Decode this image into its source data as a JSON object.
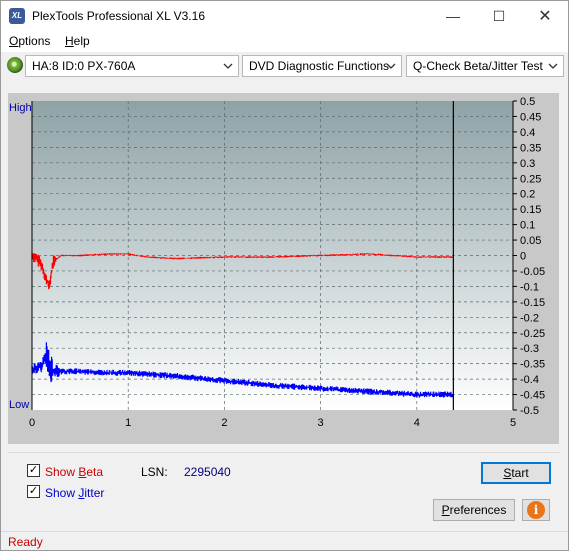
{
  "window": {
    "title": "PlexTools Professional XL V3.16"
  },
  "menu": {
    "options": "ptions",
    "options_key": "O",
    "help": "elp",
    "help_key": "H"
  },
  "toolbar": {
    "drive": "HA:8 ID:0  PX-760A",
    "function": "DVD Diagnostic Functions",
    "test": "Q-Check Beta/Jitter Test"
  },
  "chart_data": {
    "type": "line",
    "left_axis_labels": {
      "high": "High",
      "low": "Low"
    },
    "x_ticks": [
      "0",
      "1",
      "2",
      "3",
      "4",
      "5"
    ],
    "xlim": [
      0,
      5
    ],
    "y_ticks": [
      "0.5",
      "0.45",
      "0.4",
      "0.35",
      "0.3",
      "0.25",
      "0.2",
      "0.15",
      "0.1",
      "0.05",
      "0",
      "-0.05",
      "-0.1",
      "-0.15",
      "-0.2",
      "-0.25",
      "-0.3",
      "-0.35",
      "-0.4",
      "-0.45",
      "-0.5"
    ],
    "ylim": [
      -0.5,
      0.5
    ],
    "end_marker_x": 4.38,
    "grid": true,
    "series": [
      {
        "name": "Beta",
        "color": "#ff0000",
        "x": [
          0.0,
          0.05,
          0.1,
          0.15,
          0.18,
          0.22,
          0.3,
          0.5,
          0.8,
          1.0,
          1.2,
          1.5,
          2.0,
          2.5,
          3.0,
          3.5,
          4.0,
          4.38
        ],
        "y": [
          0.0,
          -0.01,
          -0.03,
          -0.08,
          -0.1,
          -0.02,
          0.0,
          0.0,
          0.005,
          0.005,
          -0.005,
          -0.01,
          -0.005,
          -0.005,
          0.0,
          0.005,
          -0.005,
          -0.005
        ]
      },
      {
        "name": "Jitter",
        "color": "#0000ff",
        "x": [
          0.0,
          0.1,
          0.15,
          0.2,
          0.3,
          0.5,
          0.8,
          1.0,
          1.5,
          2.0,
          2.5,
          3.0,
          3.5,
          4.0,
          4.38
        ],
        "y": [
          -0.37,
          -0.36,
          -0.32,
          -0.37,
          -0.375,
          -0.375,
          -0.38,
          -0.38,
          -0.39,
          -0.405,
          -0.42,
          -0.43,
          -0.44,
          -0.45,
          -0.45
        ]
      }
    ]
  },
  "options": {
    "show_beta": {
      "label": "Show ",
      "key": "B",
      "rest": "eta",
      "checked": true,
      "color": "#cc0000"
    },
    "show_jitter": {
      "label": "Show ",
      "key": "J",
      "rest": "itter",
      "checked": true,
      "color": "#0000cc"
    },
    "lsn_label": "LSN:",
    "lsn_value": "2295040"
  },
  "buttons": {
    "start": "tart",
    "start_key": "S",
    "preferences": "references",
    "preferences_key": "P",
    "info": "i"
  },
  "status": {
    "text": "Ready"
  }
}
